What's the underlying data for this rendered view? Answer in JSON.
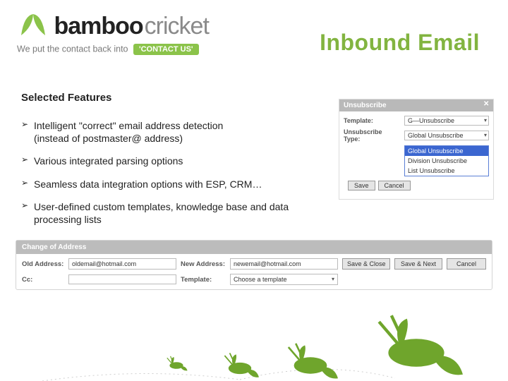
{
  "brand": {
    "name_bold": "bamboo",
    "name_light": "cricket",
    "tagline_pre": "We put the contact back into",
    "tagline_pill": "'CONTACT US'"
  },
  "title": "Inbound Email",
  "section_title": "Selected Features",
  "bullets": [
    {
      "line1": "Intelligent \"correct\" email address detection",
      "line2": "(instead of postmaster@ address)"
    },
    {
      "line1": "Various integrated parsing options"
    },
    {
      "line1": "Seamless data integration options with ESP, CRM…"
    },
    {
      "line1": "User-defined custom templates, knowledge base and data processing lists"
    }
  ],
  "unsub_panel": {
    "title": "Unsubscribe",
    "fields": {
      "template_label": "Template:",
      "template_value": "G—Unsubscribe",
      "type_label": "Unsubscribe Type:"
    },
    "dropdown": {
      "options": [
        "Global Unsubscribe",
        "Division Unsubscribe",
        "List Unsubscribe"
      ],
      "selected": "Global Unsubscribe"
    },
    "buttons": {
      "save": "Save",
      "cancel": "Cancel"
    }
  },
  "coa_panel": {
    "title": "Change of Address",
    "labels": {
      "old": "Old Address:",
      "new": "New Address:",
      "cc": "Cc:",
      "template": "Template:"
    },
    "values": {
      "old": "oldemail@hotmail.com",
      "new": "newemail@hotmail.com",
      "cc": "",
      "template": "Choose a template"
    },
    "buttons": {
      "save_close": "Save & Close",
      "save_next": "Save & Next",
      "cancel": "Cancel"
    }
  }
}
